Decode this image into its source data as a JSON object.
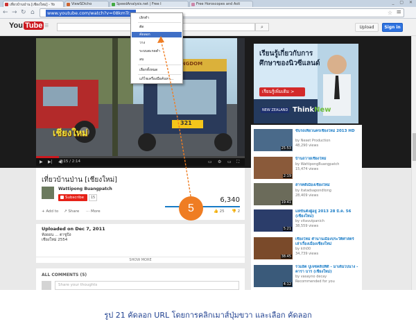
{
  "browser": {
    "tabs": [
      "เที่ยวบ้านป่าน [เชียงใหม่] - Yo",
      "ViewSDicho",
      "SpeedAnalysis.net | Free I",
      "Free Horoscopes and Asti"
    ],
    "url": "www.youtube.com/watch?v=08kmTr..."
  },
  "context_menu": {
    "items": [
      "เลิกทำ",
      "ตัด",
      "คัดลอก",
      "วาง",
      "ระบบสะกดคำ",
      "ลบ",
      "เลือกทั้งหมด",
      "แก้ไขเครื่องมือค้นหา..."
    ],
    "highlighted_index": 2
  },
  "youtube": {
    "logo_text": "You",
    "logo_tube": "Tube",
    "upload": "Upload",
    "signin": "Sign in",
    "video_overlay": "เชียงใหม่",
    "sign_text": "TIGER KINGDOM",
    "plate": "321",
    "time": "0:15 / 2:14",
    "video_title": "เที่ยวบ้านป่าน [เชียงใหม่]",
    "channel": "Wattipong Buangpatch",
    "subscribe": "Subscribe",
    "sub_count": "15",
    "views": "6,340",
    "like_count": "25",
    "dislike_count": "2",
    "actions": [
      "Add to",
      "Share",
      "More"
    ],
    "uploaded": "Uploaded on Dec 7, 2011",
    "description": [
      "ห้อยอน ... ตาขูปิง",
      "เชียงใหม่ 2554"
    ],
    "show_more": "SHOW MORE",
    "comments": "ALL COMMENTS (5)",
    "comment_placeholder": "Share your thoughts"
  },
  "ad": {
    "title": "เรียนรู้เกี่ยวกับการศึกษาของนิวซีแลนด์",
    "button": "เรียนรู้เพิ่มเติม >",
    "logo_nz": "NEW ZEALAND",
    "logo_think": "Think",
    "logo_new": "New"
  },
  "sidebar": [
    {
      "title": "ขับรถเที่ยวนครเชียงใหม่ 2013 HD",
      "by": "by Nexet Production",
      "views": "48,290 views",
      "duration": "25:53"
    },
    {
      "title": "บ้านถวายเชียงใหม่",
      "by": "by WattipongBuangpatch",
      "views": "15,474 views",
      "duration": "2:19"
    },
    {
      "title": "สารคดีเมืองเชียงใหม่",
      "by": "by itatadsapondtong",
      "views": "28,409 views",
      "duration": "19:41"
    },
    {
      "title": "แห่ขันตั้งผู้อยู่ 2013 28 มี.ค. 56 (เชียงใหม่)",
      "by": "by vitavutpanich",
      "views": "38,559 views",
      "duration": "5:21"
    },
    {
      "title": "เชียงใหม่ ตำนานเมืองประวัติศาสตร์ เล่าเรื่องเมืองเชียงใหม่",
      "by": "by kth00",
      "views": "34,739 views",
      "duration": "38:45"
    },
    {
      "title": "รวมฮิต ปูเจซคลิปที่ดี - มาเดิมไปนาง - คารา บาร (เชียงใหม่)",
      "by": "by vasayno decay",
      "views": "Recommended for you",
      "duration": "4:12"
    }
  ],
  "annotation": {
    "step": "5"
  },
  "caption": "รูป 21 คัดลอก URL โดยการคลิกเมาส์ปุ่มขวา และเลือก คัดลอก",
  "colors": {
    "accent_orange": "#ef7d23",
    "youtube_red": "#cc181e",
    "signin_blue": "#2f73e0",
    "caption_blue": "#1e3f8f"
  },
  "progress_fraction": 0.11
}
